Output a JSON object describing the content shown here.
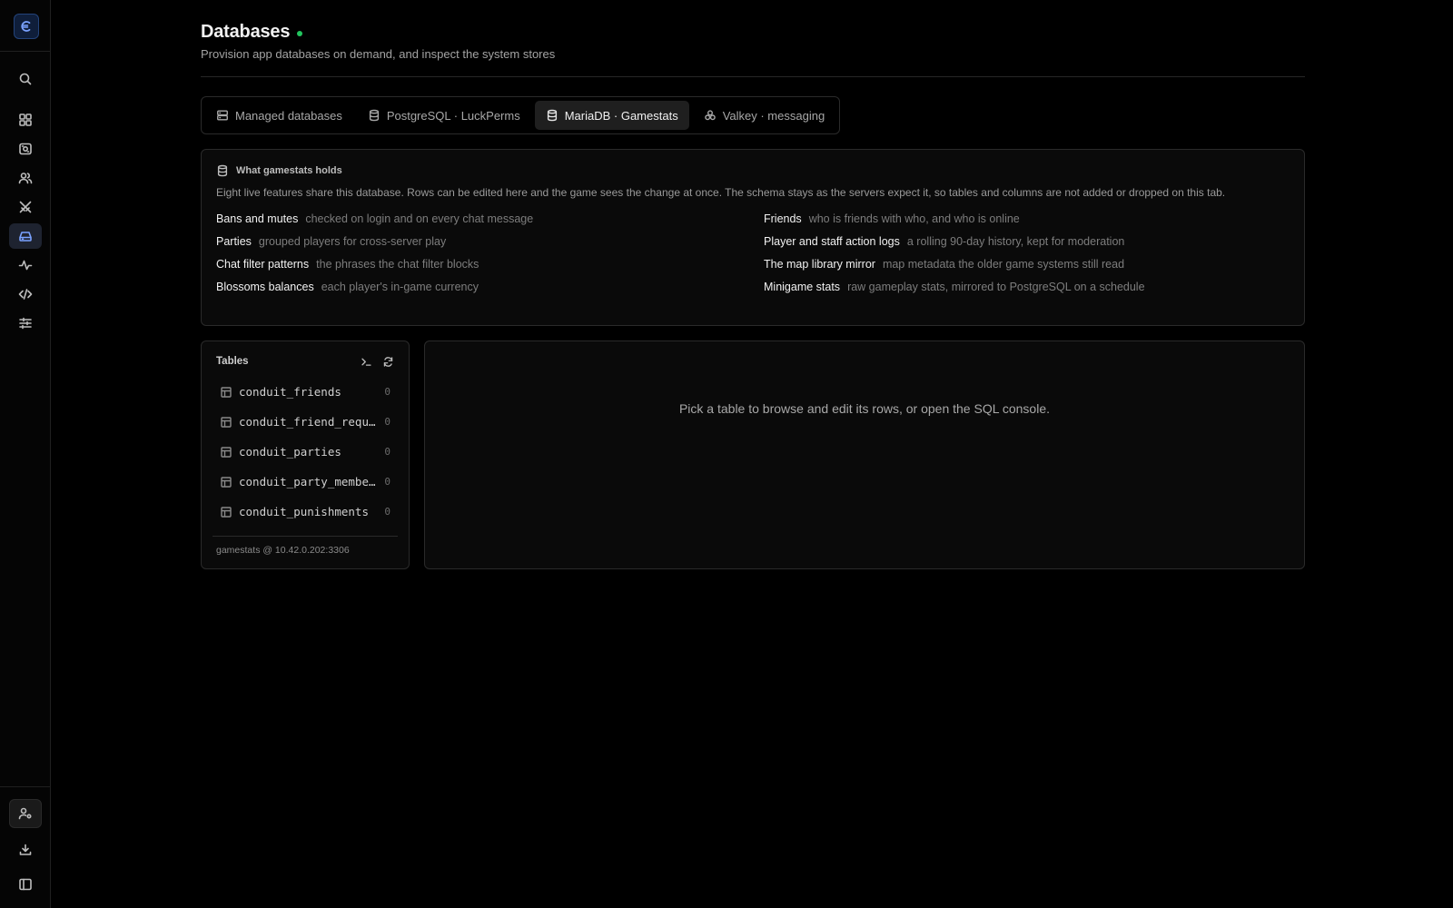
{
  "sidebar": {
    "logo_glyph": "€",
    "accent": "#7aa2ff"
  },
  "page": {
    "title": "Databases",
    "subtitle": "Provision app databases on demand, and inspect the system stores",
    "status_color": "#22c55e"
  },
  "tabs": [
    {
      "label": "Managed databases",
      "icon": "server-icon",
      "active": false
    },
    {
      "label": "PostgreSQL · LuckPerms",
      "icon": "database-icon",
      "active": false
    },
    {
      "label": "MariaDB · Gamestats",
      "icon": "database-icon",
      "active": true
    },
    {
      "label": "Valkey · messaging",
      "icon": "cluster-icon",
      "active": false
    }
  ],
  "info": {
    "heading": "What gamestats holds",
    "description": "Eight live features share this database. Rows can be edited here and the game sees the change at once. The schema stays as the servers expect it, so tables and columns are not added or dropped on this tab.",
    "features": [
      {
        "name": "Bans and mutes",
        "desc": "checked on login and on every chat message"
      },
      {
        "name": "Friends",
        "desc": "who is friends with who, and who is online"
      },
      {
        "name": "Parties",
        "desc": "grouped players for cross-server play"
      },
      {
        "name": "Player and staff action logs",
        "desc": "a rolling 90-day history, kept for moderation"
      },
      {
        "name": "Chat filter patterns",
        "desc": "the phrases the chat filter blocks"
      },
      {
        "name": "The map library mirror",
        "desc": "map metadata the older game systems still read"
      },
      {
        "name": "Blossoms balances",
        "desc": "each player's in-game currency"
      },
      {
        "name": "Minigame stats",
        "desc": "raw gameplay stats, mirrored to PostgreSQL on a schedule"
      }
    ]
  },
  "tables": {
    "title": "Tables",
    "items": [
      {
        "name": "conduit_friends",
        "count": "0"
      },
      {
        "name": "conduit_friend_requests",
        "count": "0"
      },
      {
        "name": "conduit_parties",
        "count": "0"
      },
      {
        "name": "conduit_party_members",
        "count": "0"
      },
      {
        "name": "conduit_punishments",
        "count": "0"
      }
    ],
    "connection": "gamestats @ 10.42.0.202:3306"
  },
  "browser": {
    "empty_message": "Pick a table to browse and edit its rows, or open the SQL console."
  }
}
